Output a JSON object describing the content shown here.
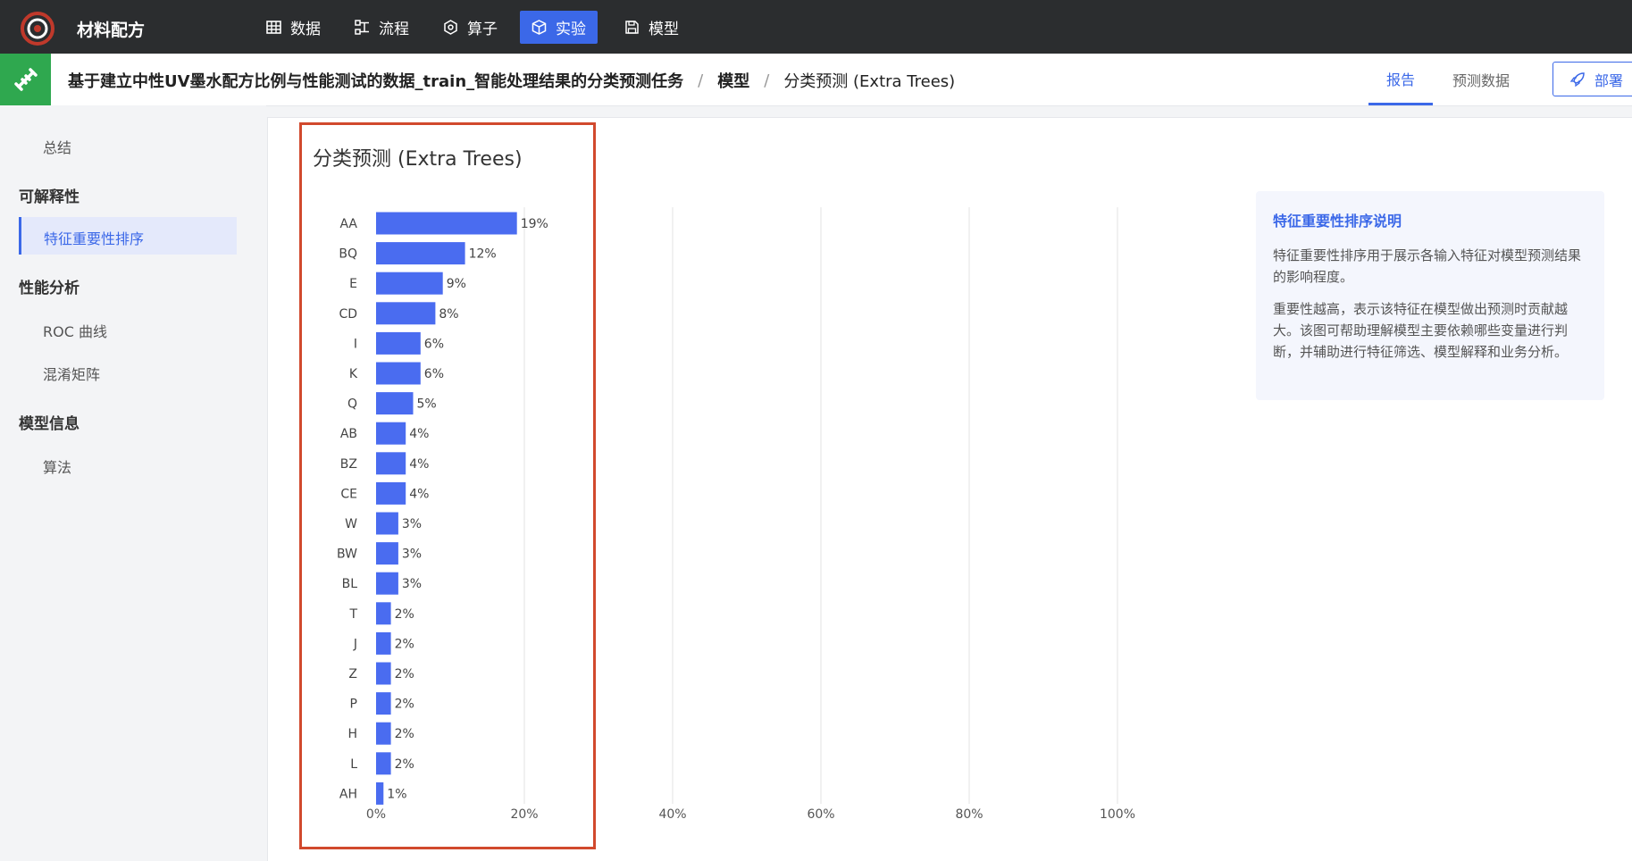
{
  "topbar": {
    "app_title": "材料配方",
    "nav": [
      {
        "label": "数据",
        "icon": "table-icon"
      },
      {
        "label": "流程",
        "icon": "flow-icon"
      },
      {
        "label": "算子",
        "icon": "hexagon-icon"
      },
      {
        "label": "实验",
        "icon": "cube-icon",
        "active": true
      },
      {
        "label": "模型",
        "icon": "save-icon"
      }
    ]
  },
  "breadcrumb": {
    "items": [
      "基于建立中性UV墨水配方比例与性能测试的数据_train_智能处理结果的分类预测任务",
      "模型",
      "分类预测 (Extra Trees)"
    ],
    "separator": "/"
  },
  "tabs": [
    {
      "label": "报告",
      "active": true
    },
    {
      "label": "预测数据",
      "active": false
    }
  ],
  "deploy_label": "部署",
  "sidebar": {
    "summary": "总结",
    "group_explain": "可解释性",
    "feature_rank": "特征重要性排序",
    "group_perf": "性能分析",
    "roc": "ROC 曲线",
    "confusion": "混淆矩阵",
    "group_model": "模型信息",
    "algorithm": "算法"
  },
  "chart_title": "分类预测 (Extra Trees)",
  "chart_data": {
    "type": "bar",
    "orientation": "horizontal",
    "categories": [
      "AA",
      "BQ",
      "E",
      "CD",
      "I",
      "K",
      "Q",
      "AB",
      "BZ",
      "CE",
      "W",
      "BW",
      "BL",
      "T",
      "J",
      "Z",
      "P",
      "H",
      "L",
      "AH"
    ],
    "values": [
      19,
      12,
      9,
      8,
      6,
      6,
      5,
      4,
      4,
      4,
      3,
      3,
      3,
      2,
      2,
      2,
      2,
      2,
      2,
      1
    ],
    "data_labels": [
      "19%",
      "12%",
      "9%",
      "8%",
      "6%",
      "6%",
      "5%",
      "4%",
      "4%",
      "4%",
      "3%",
      "3%",
      "3%",
      "2%",
      "2%",
      "2%",
      "2%",
      "2%",
      "2%",
      "1%"
    ],
    "xlim": [
      0,
      100
    ],
    "x_ticks": [
      "0%",
      "20%",
      "40%",
      "60%",
      "80%",
      "100%"
    ],
    "grid": true,
    "bar_color": "#4a6cf0"
  },
  "info": {
    "title": "特征重要性排序说明",
    "p1": "特征重要性排序用于展示各输入特征对模型预测结果的影响程度。",
    "p2": "重要性越高，表示该特征在模型做出预测时贡献越大。该图可帮助理解模型主要依赖哪些变量进行判断，并辅助进行特征筛选、模型解释和业务分析。"
  },
  "colors": {
    "accent": "#3b68e8",
    "topbar": "#2b2d2f",
    "crumb_icon_bg": "#2fa84f",
    "highlight": "#d1492d"
  }
}
